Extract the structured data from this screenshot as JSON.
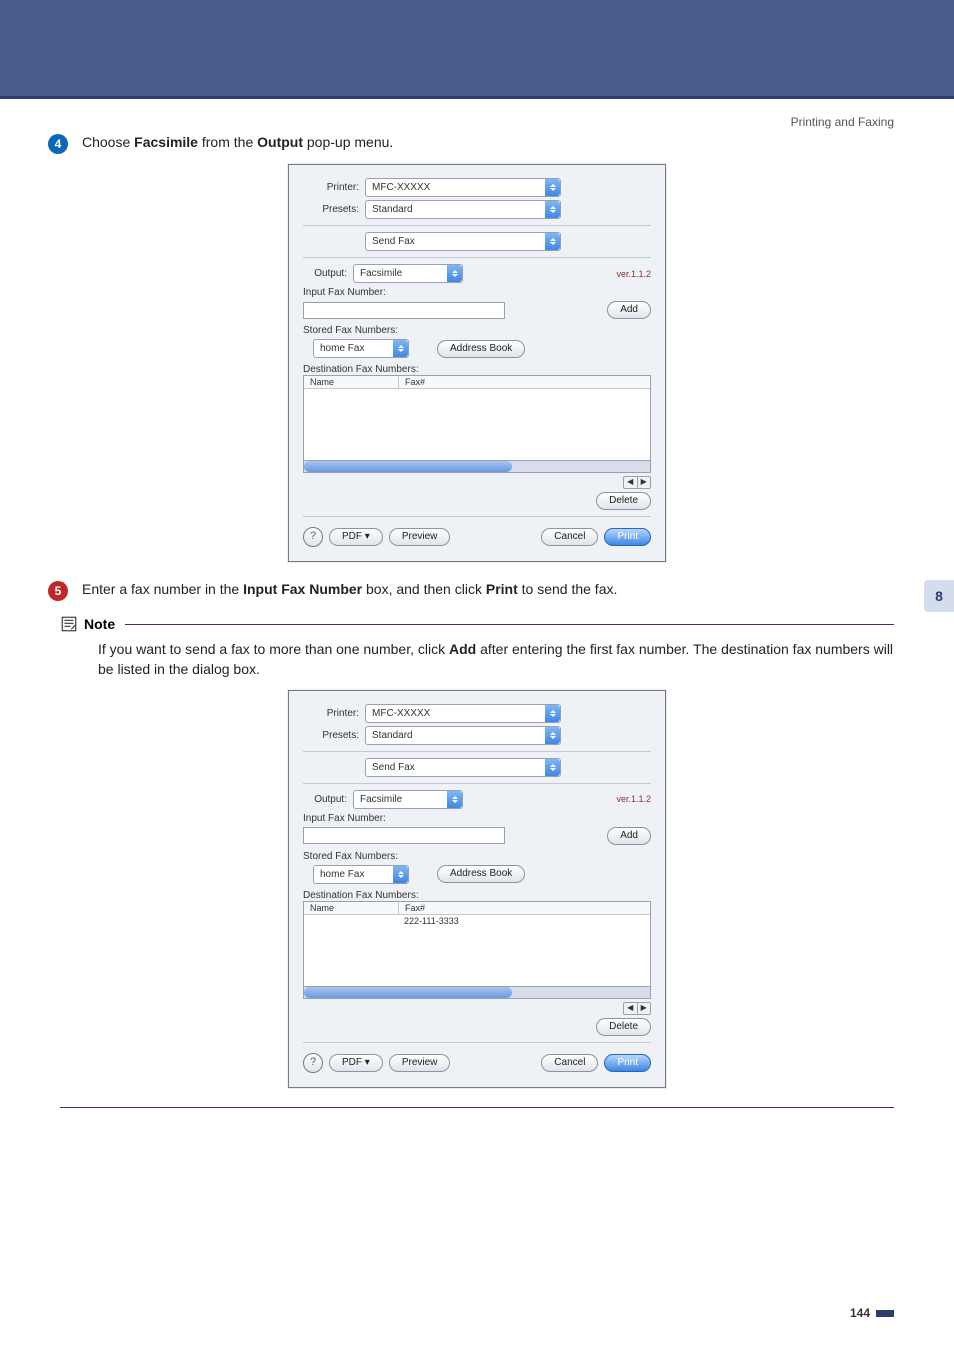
{
  "header": {
    "breadcrumb": "Printing and Faxing"
  },
  "steps": {
    "four": {
      "num": "4",
      "color": "#0b66b8",
      "pre": "Choose ",
      "b1": "Facsimile",
      "mid1": " from the ",
      "b2": "Output",
      "post": " pop-up menu."
    },
    "five": {
      "num": "5",
      "color": "#c02828",
      "pre": "Enter a fax number in the ",
      "b1": "Input Fax Number",
      "mid1": " box, and then click ",
      "b2": "Print",
      "post": " to send the fax."
    }
  },
  "note": {
    "title": "Note",
    "body_pre": "If you want to send a fax to more than one number, click ",
    "body_b": "Add",
    "body_post": " after entering the first fax number. The destination fax numbers will be listed in the dialog box."
  },
  "dialog": {
    "printer_label": "Printer:",
    "printer_value": "MFC-XXXXX",
    "presets_label": "Presets:",
    "presets_value": "Standard",
    "pane_value": "Send Fax",
    "output_label": "Output:",
    "output_value": "Facsimile",
    "version": "ver.1.1.2",
    "input_fax_label": "Input Fax Number:",
    "add": "Add",
    "stored_label": "Stored Fax Numbers:",
    "stored_value": "home Fax",
    "address_book": "Address Book",
    "dest_label": "Destination Fax Numbers:",
    "col_name": "Name",
    "col_fax": "Fax#",
    "delete": "Delete",
    "help": "?",
    "pdf": "PDF ▾",
    "preview": "Preview",
    "cancel": "Cancel",
    "print": "Print",
    "nav_left": "◀",
    "nav_right": "▶"
  },
  "dialog2_row": {
    "fax": "222-111-3333"
  },
  "sidetab": "8",
  "pagenum": "144"
}
